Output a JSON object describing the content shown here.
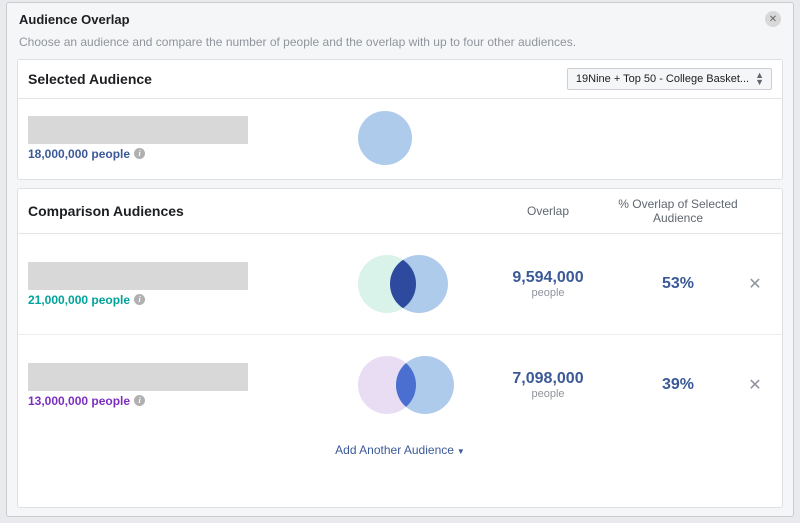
{
  "modal": {
    "title": "Audience Overlap",
    "subtitle": "Choose an audience and compare the number of people and the overlap with up to four other audiences."
  },
  "selected": {
    "panel_title": "Selected Audience",
    "dropdown_label": "19Nine + Top 50 - College Basket...",
    "count_text": "18,000,000 people",
    "count_color": "#3b5998"
  },
  "comparison": {
    "panel_title": "Comparison Audiences",
    "col_overlap": "Overlap",
    "col_pct": "% Overlap of Selected Audience",
    "people_label": "people",
    "add_label": "Add Another Audience",
    "rows": [
      {
        "count_text": "21,000,000 people",
        "count_color": "#00a39a",
        "overlap_text": "9,594,000",
        "pct_text": "53%",
        "venn_left_color": "#d9f2ea",
        "venn_right_color": "#aecbeb",
        "venn_mid_color": "#2d4a9e",
        "venn_offset": "32px"
      },
      {
        "count_text": "13,000,000 people",
        "count_color": "#7b2fbf",
        "overlap_text": "7,098,000",
        "pct_text": "39%",
        "venn_left_color": "#e9ddf3",
        "venn_right_color": "#aecbeb",
        "venn_mid_color": "#4a6fd1",
        "venn_offset": "38px"
      }
    ]
  }
}
